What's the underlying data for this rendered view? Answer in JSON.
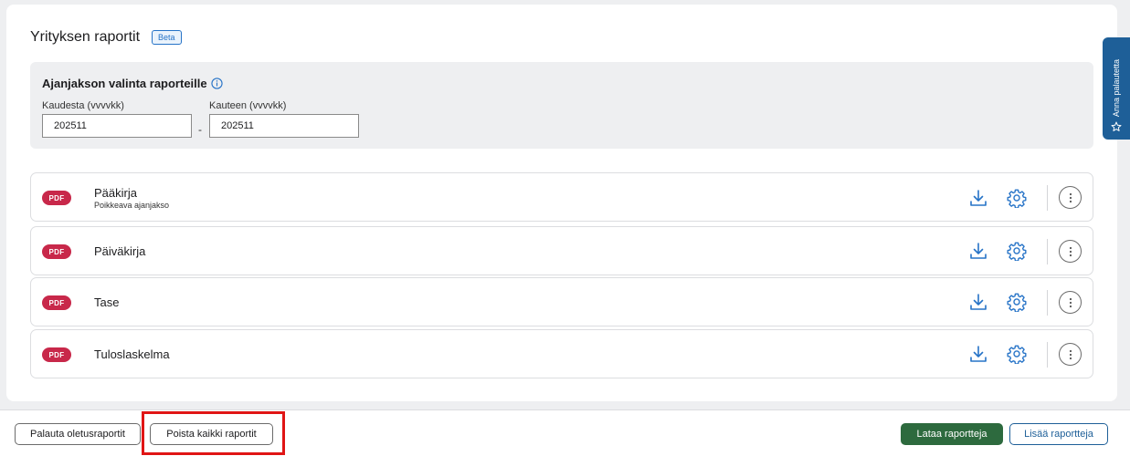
{
  "header": {
    "title": "Yrityksen raportit",
    "badge": "Beta"
  },
  "period": {
    "heading": "Ajanjakson valinta raporteille",
    "from_label": "Kaudesta (vvvvkk)",
    "from_value": "202511",
    "to_label": "Kauteen (vvvvkk)",
    "to_value": "202511",
    "separator": "-"
  },
  "reports": [
    {
      "badge": "PDF",
      "name": "Pääkirja",
      "subtitle": "Poikkeava ajanjakso"
    },
    {
      "badge": "PDF",
      "name": "Päiväkirja",
      "subtitle": ""
    },
    {
      "badge": "PDF",
      "name": "Tase",
      "subtitle": ""
    },
    {
      "badge": "PDF",
      "name": "Tuloslaskelma",
      "subtitle": ""
    }
  ],
  "feedback": {
    "label": "Anna palautetta"
  },
  "footer": {
    "restore_label": "Palauta oletusraportit",
    "remove_all_label": "Poista kaikki raportit",
    "download_label": "Lataa raportteja",
    "add_label": "Lisää raportteja"
  },
  "colors": {
    "pdf_badge": "#c8284a",
    "accent_blue": "#1e5f98",
    "primary_green": "#2d6a3e",
    "highlight_frame": "#e01515"
  },
  "icons": [
    "info-icon",
    "download-icon",
    "gear-icon",
    "more-vertical-icon",
    "star-icon"
  ]
}
